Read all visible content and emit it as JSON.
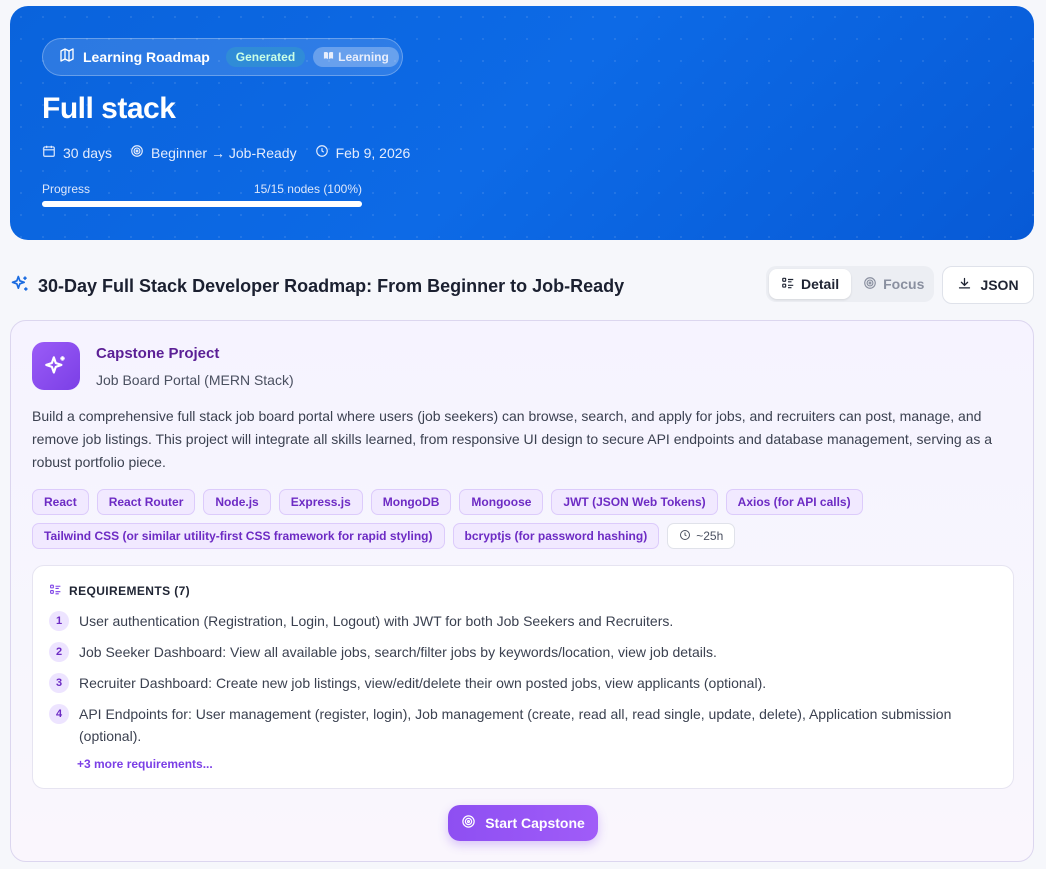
{
  "hero": {
    "badge_label": "Learning Roadmap",
    "badge_generated": "Generated",
    "badge_learning": "Learning",
    "title": "Full stack",
    "duration": "30 days",
    "level": "Beginner → Job-Ready",
    "date": "Feb 9, 2026",
    "progress_label": "Progress",
    "progress_value": "15/15 nodes (100%)",
    "progress_fraction": 1.0
  },
  "section": {
    "title": "30-Day Full Stack Developer Roadmap: From Beginner to Job-Ready",
    "view_detail": "Detail",
    "view_focus": "Focus",
    "json_label": "JSON"
  },
  "capstone": {
    "title": "Capstone Project",
    "subtitle": "Job Board Portal (MERN Stack)",
    "description": "Build a comprehensive full stack job board portal where users (job seekers) can browse, search, and apply for jobs, and recruiters can post, manage, and remove job listings. This project will integrate all skills learned, from responsive UI design to secure API endpoints and database management, serving as a robust portfolio piece.",
    "tags": [
      "React",
      "React Router",
      "Node.js",
      "Express.js",
      "MongoDB",
      "Mongoose",
      "JWT (JSON Web Tokens)",
      "Axios (for API calls)",
      "Tailwind CSS (or similar utility-first CSS framework for rapid styling)",
      "bcryptjs (for password hashing)"
    ],
    "time": "~25h",
    "requirements_title": "REQUIREMENTS (7)",
    "requirements": [
      {
        "num": "1",
        "text": "User authentication (Registration, Login, Logout) with JWT for both Job Seekers and Recruiters."
      },
      {
        "num": "2",
        "text": "Job Seeker Dashboard: View all available jobs, search/filter jobs by keywords/location, view job details."
      },
      {
        "num": "3",
        "text": "Recruiter Dashboard: Create new job listings, view/edit/delete their own posted jobs, view applicants (optional)."
      },
      {
        "num": "4",
        "text": "API Endpoints for: User management (register, login), Job management (create, read all, read single, update, delete), Application submission (optional)."
      }
    ],
    "more_requirements": "+3 more requirements...",
    "start_label": "Start Capstone"
  }
}
